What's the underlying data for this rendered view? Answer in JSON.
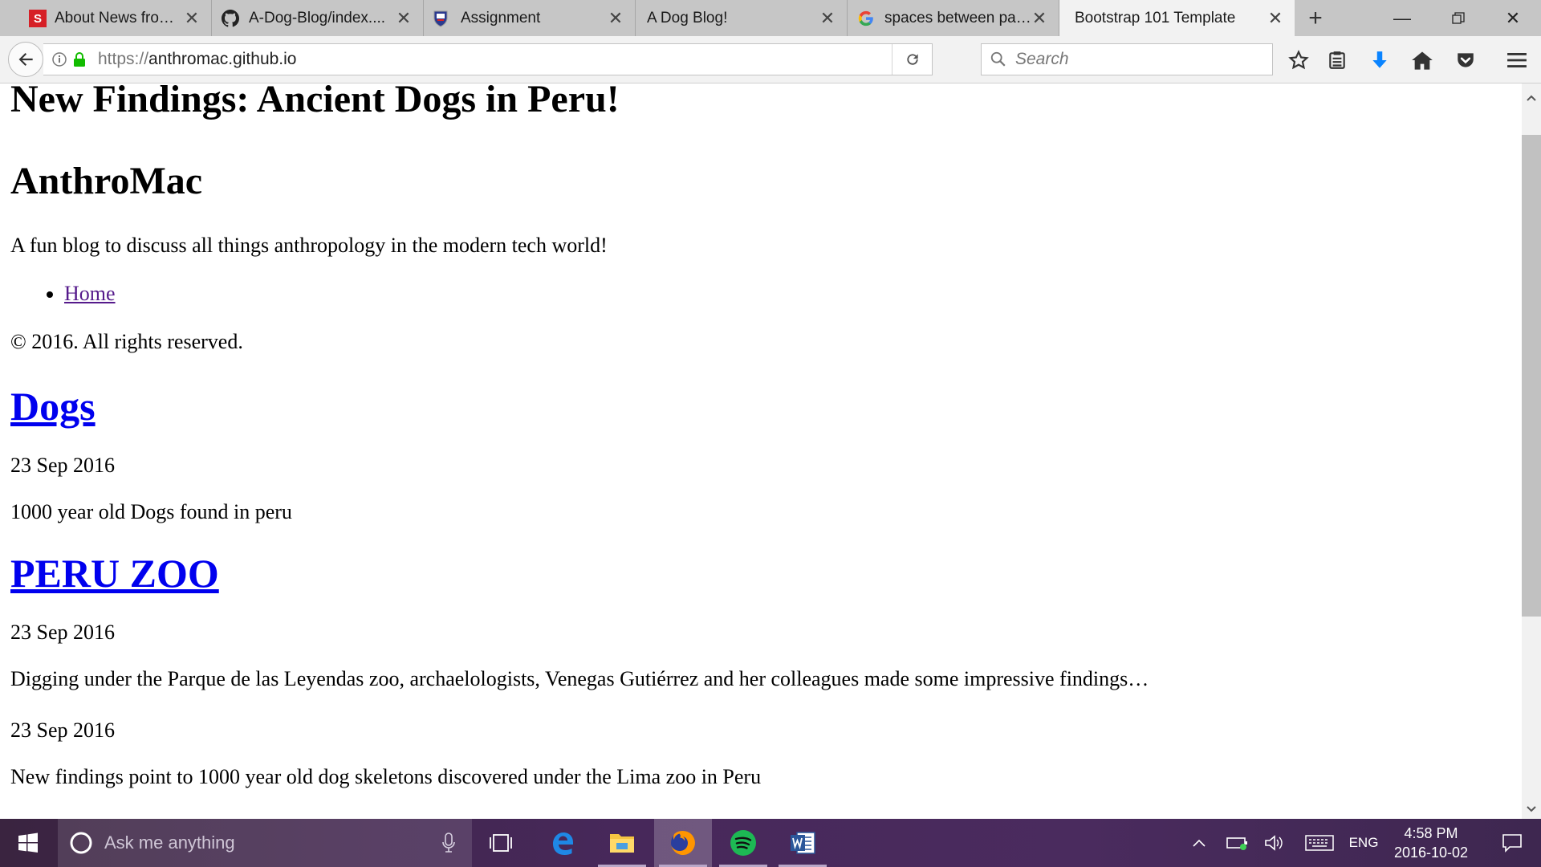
{
  "tabs": [
    {
      "title": "About News from S...",
      "favicon": "s-logo-icon"
    },
    {
      "title": "A-Dog-Blog/index....",
      "favicon": "github-icon"
    },
    {
      "title": "Assignment",
      "favicon": "shield-crest-icon"
    },
    {
      "title": "A Dog Blog!",
      "favicon": ""
    },
    {
      "title": "spaces between par...",
      "favicon": "google-icon"
    },
    {
      "title": "Bootstrap 101 Template",
      "favicon": "",
      "active": true
    }
  ],
  "address_bar": {
    "scheme": "https://",
    "host": "anthromac.github.io"
  },
  "search_bar": {
    "placeholder": "Search"
  },
  "page": {
    "heading": "New Findings: Ancient Dogs in Peru!",
    "site_title": "AnthroMac",
    "tagline": "A fun blog to discuss all things anthropology in the modern tech world!",
    "nav_links": [
      "Home"
    ],
    "copyright": "© 2016. All rights reserved.",
    "posts": [
      {
        "title": "Dogs",
        "date": "23 Sep 2016",
        "excerpt": "1000 year old Dogs found in peru"
      },
      {
        "title": "PERU ZOO",
        "date": "23 Sep 2016",
        "excerpt": "Digging under the Parque de las Leyendas zoo, archaelologists, Venegas Gutiérrez and her colleagues made some impressive findings…"
      }
    ],
    "extra": {
      "date": "23 Sep 2016",
      "text": "New findings point to 1000 year old dog skeletons discovered under the Lima zoo in Peru"
    }
  },
  "taskbar": {
    "search_placeholder": "Ask me anything",
    "language": "ENG",
    "time": "4:58 PM",
    "date": "2016-10-02"
  },
  "colors": {
    "link": "#0000ee",
    "visited_link": "#551a8b",
    "taskbar": "#47285a",
    "download_arrow": "#0a84ff",
    "spotify": "#1db954"
  }
}
